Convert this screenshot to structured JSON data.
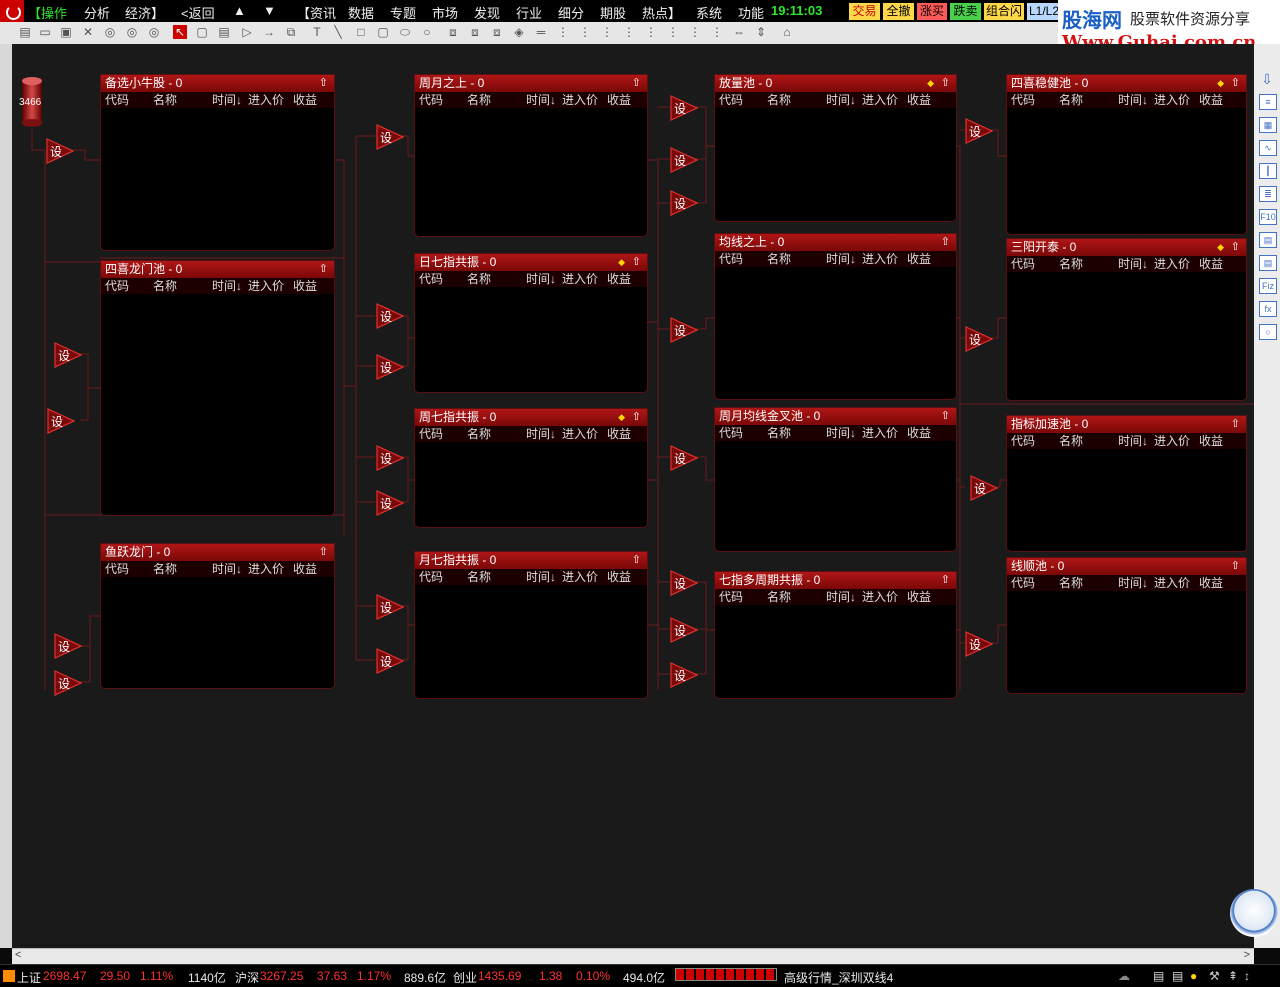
{
  "menubar": {
    "items": [
      "【操作",
      "分析",
      "经济】",
      "<返回",
      "▲",
      "▼",
      "【资讯",
      "数据",
      "专题",
      "市场",
      "发现",
      "行业",
      "细分",
      "期股",
      "热点】",
      "系统",
      "功能"
    ],
    "clock": "19:11:03",
    "buttons": [
      "交易",
      "全撤",
      "涨买",
      "跌卖",
      "组合闪",
      "L1/L2"
    ]
  },
  "watermark": {
    "brand": "股海网",
    "slogan": "股票软件资源分享",
    "url": "Www.Guhai.com.cn"
  },
  "cylinder_value": "3466",
  "trigger_label": "设",
  "columns": [
    "代码",
    "名称",
    "时间↓",
    "进入价",
    "收益"
  ],
  "pools": [
    {
      "title": "备选小牛股 - 0",
      "diamond": false
    },
    {
      "title": "四喜龙门池 - 0",
      "diamond": false
    },
    {
      "title": "鱼跃龙门 - 0",
      "diamond": false
    },
    {
      "title": "周月之上 - 0",
      "diamond": false
    },
    {
      "title": "日七指共振 - 0",
      "diamond": true
    },
    {
      "title": "周七指共振 - 0",
      "diamond": true
    },
    {
      "title": "月七指共振 - 0",
      "diamond": false
    },
    {
      "title": "放量池 - 0",
      "diamond": true
    },
    {
      "title": "均线之上 - 0",
      "diamond": false
    },
    {
      "title": "周月均线金叉池 - 0",
      "diamond": false
    },
    {
      "title": "七指多周期共振 - 0",
      "diamond": false
    },
    {
      "title": "四喜稳健池 - 0",
      "diamond": true
    },
    {
      "title": "三阳开泰 - 0",
      "diamond": true
    },
    {
      "title": "指标加速池 - 0",
      "diamond": false
    },
    {
      "title": "线顺池 - 0",
      "diamond": false
    }
  ],
  "statusbar": {
    "sh": {
      "name": "上证",
      "value": "2698.47",
      "change": "29.50",
      "pct": "1.11%",
      "amount": "1140亿"
    },
    "hs": {
      "name": "沪深",
      "value": "3267.25",
      "change": "37.63",
      "pct": "1.17%",
      "amount": "889.6亿"
    },
    "cy": {
      "name": "创业",
      "value": "1435.69",
      "change": "1.38",
      "pct": "0.10%",
      "amount": "494.0亿"
    },
    "feed": "高级行情_深圳双线4"
  },
  "colors": {
    "pool_header": "#b01616",
    "accent_green": "#2ee62e",
    "index_red": "#ff3030"
  }
}
